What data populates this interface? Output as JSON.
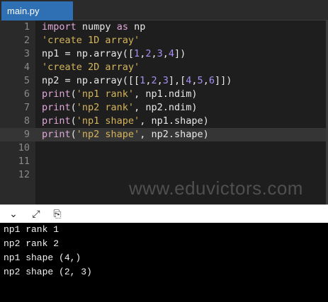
{
  "tab": {
    "label": "main.py"
  },
  "editor": {
    "lines": [
      {
        "num": "1",
        "tokens": [
          {
            "t": "import",
            "c": "kw"
          },
          {
            "t": " numpy ",
            "c": "op"
          },
          {
            "t": "as",
            "c": "kw"
          },
          {
            "t": " np",
            "c": "op"
          }
        ]
      },
      {
        "num": "2",
        "tokens": [
          {
            "t": "'create 1D array'",
            "c": "str"
          }
        ]
      },
      {
        "num": "3",
        "tokens": [
          {
            "t": "np1 = np.array([",
            "c": "op"
          },
          {
            "t": "1",
            "c": "num"
          },
          {
            "t": ",",
            "c": "op"
          },
          {
            "t": "2",
            "c": "num"
          },
          {
            "t": ",",
            "c": "op"
          },
          {
            "t": "3",
            "c": "num"
          },
          {
            "t": ",",
            "c": "op"
          },
          {
            "t": "4",
            "c": "num"
          },
          {
            "t": "])",
            "c": "op"
          }
        ]
      },
      {
        "num": "4",
        "tokens": [
          {
            "t": "'create 2D array'",
            "c": "str"
          }
        ]
      },
      {
        "num": "5",
        "tokens": [
          {
            "t": "np2 = np.array([[",
            "c": "op"
          },
          {
            "t": "1",
            "c": "num"
          },
          {
            "t": ",",
            "c": "op"
          },
          {
            "t": "2",
            "c": "num"
          },
          {
            "t": ",",
            "c": "op"
          },
          {
            "t": "3",
            "c": "num"
          },
          {
            "t": "],[",
            "c": "op"
          },
          {
            "t": "4",
            "c": "num"
          },
          {
            "t": ",",
            "c": "op"
          },
          {
            "t": "5",
            "c": "num"
          },
          {
            "t": ",",
            "c": "op"
          },
          {
            "t": "6",
            "c": "num"
          },
          {
            "t": "]])",
            "c": "op"
          }
        ]
      },
      {
        "num": "6",
        "tokens": [
          {
            "t": "print",
            "c": "fn"
          },
          {
            "t": "(",
            "c": "op"
          },
          {
            "t": "'np1 rank'",
            "c": "str"
          },
          {
            "t": ", np1.ndim)",
            "c": "op"
          }
        ]
      },
      {
        "num": "7",
        "tokens": [
          {
            "t": "print",
            "c": "fn"
          },
          {
            "t": "(",
            "c": "op"
          },
          {
            "t": "'np2 rank'",
            "c": "str"
          },
          {
            "t": ", np2.ndim)",
            "c": "op"
          }
        ]
      },
      {
        "num": "8",
        "tokens": [
          {
            "t": "print",
            "c": "fn"
          },
          {
            "t": "(",
            "c": "op"
          },
          {
            "t": "'np1 shape'",
            "c": "str"
          },
          {
            "t": ", np1.shape)",
            "c": "op"
          }
        ]
      },
      {
        "num": "9",
        "tokens": [
          {
            "t": "print",
            "c": "fn"
          },
          {
            "t": "(",
            "c": "op"
          },
          {
            "t": "'np2 shape'",
            "c": "str"
          },
          {
            "t": ", np2.shape)",
            "c": "op"
          }
        ]
      },
      {
        "num": "10",
        "tokens": []
      },
      {
        "num": "11",
        "tokens": []
      },
      {
        "num": "12",
        "tokens": []
      }
    ],
    "active_line": "9",
    "watermark": "www.eduvictors.com"
  },
  "toolbar": {
    "icons": [
      {
        "name": "collapse-icon",
        "glyph": "⌄"
      },
      {
        "name": "expand-icon",
        "glyph": "⤢"
      },
      {
        "name": "copy-icon",
        "glyph": "⎘"
      }
    ]
  },
  "console": {
    "lines": [
      "np1 rank 1",
      "np2 rank 2",
      "np1 shape (4,)",
      "np2 shape (2, 3)"
    ]
  },
  "colors": {
    "tab_active": "#2f6fb4",
    "keyword": "#e0a8d8",
    "string": "#d4b45a",
    "number": "#a890f0",
    "editor_bg": "#1e1e1e",
    "console_bg": "#000000"
  }
}
